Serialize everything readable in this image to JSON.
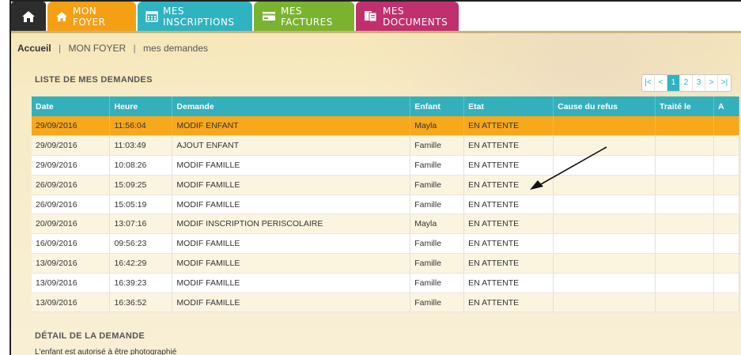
{
  "nav": {
    "tabs": [
      {
        "label": "",
        "icon": "home-icon"
      },
      {
        "label": "MON FOYER",
        "icon": "house-icon"
      },
      {
        "label": "MES INSCRIPTIONS",
        "icon": "calendar-icon"
      },
      {
        "label": "MES FACTURES",
        "icon": "card-icon"
      },
      {
        "label": "MES DOCUMENTS",
        "icon": "documents-icon"
      }
    ]
  },
  "breadcrumb": {
    "home": "Accueil",
    "sep1": "|",
    "level1": "MON FOYER",
    "sep2": "|",
    "level2": "mes demandes"
  },
  "list": {
    "title": "LISTE DE MES DEMANDES",
    "pager": [
      "|<",
      "<",
      "1",
      "2",
      "3",
      ">",
      ">|"
    ],
    "columns": [
      "Date",
      "Heure",
      "Demande",
      "Enfant",
      "Etat",
      "Cause du refus",
      "Traité le",
      "A"
    ],
    "rows": [
      [
        "29/09/2016",
        "11:56:04",
        "MODIF ENFANT",
        "Mayla",
        "EN ATTENTE",
        "",
        "",
        ""
      ],
      [
        "29/09/2016",
        "11:03:49",
        "AJOUT ENFANT",
        "Famille",
        "EN ATTENTE",
        "",
        "",
        ""
      ],
      [
        "29/09/2016",
        "10:08:26",
        "MODIF FAMILLE",
        "Famille",
        "EN ATTENTE",
        "",
        "",
        ""
      ],
      [
        "26/09/2016",
        "15:09:25",
        "MODIF FAMILLE",
        "Famille",
        "EN ATTENTE",
        "",
        "",
        ""
      ],
      [
        "26/09/2016",
        "15:05:19",
        "MODIF FAMILLE",
        "Famille",
        "EN ATTENTE",
        "",
        "",
        ""
      ],
      [
        "20/09/2016",
        "13:07:16",
        "MODIF INSCRIPTION PERISCOLAIRE",
        "Mayla",
        "EN ATTENTE",
        "",
        "",
        ""
      ],
      [
        "16/09/2016",
        "09:56:23",
        "MODIF FAMILLE",
        "Famille",
        "EN ATTENTE",
        "",
        "",
        ""
      ],
      [
        "13/09/2016",
        "16:42:29",
        "MODIF FAMILLE",
        "Famille",
        "EN ATTENTE",
        "",
        "",
        ""
      ],
      [
        "13/09/2016",
        "16:39:23",
        "MODIF FAMILLE",
        "Famille",
        "EN ATTENTE",
        "",
        "",
        ""
      ],
      [
        "13/09/2016",
        "16:36:52",
        "MODIF FAMILLE",
        "Famille",
        "EN ATTENTE",
        "",
        "",
        ""
      ]
    ]
  },
  "detail": {
    "title": "DÉTAIL DE LA DEMANDE",
    "text": "L'enfant est autorisé à être photographié"
  },
  "colors": {
    "foyer": "#f5a014",
    "inscriptions": "#2fb3c0",
    "factures": "#7ab32f",
    "documents": "#c0306e",
    "selected_row": "#f7a81b",
    "table_header": "#34b0bd"
  }
}
